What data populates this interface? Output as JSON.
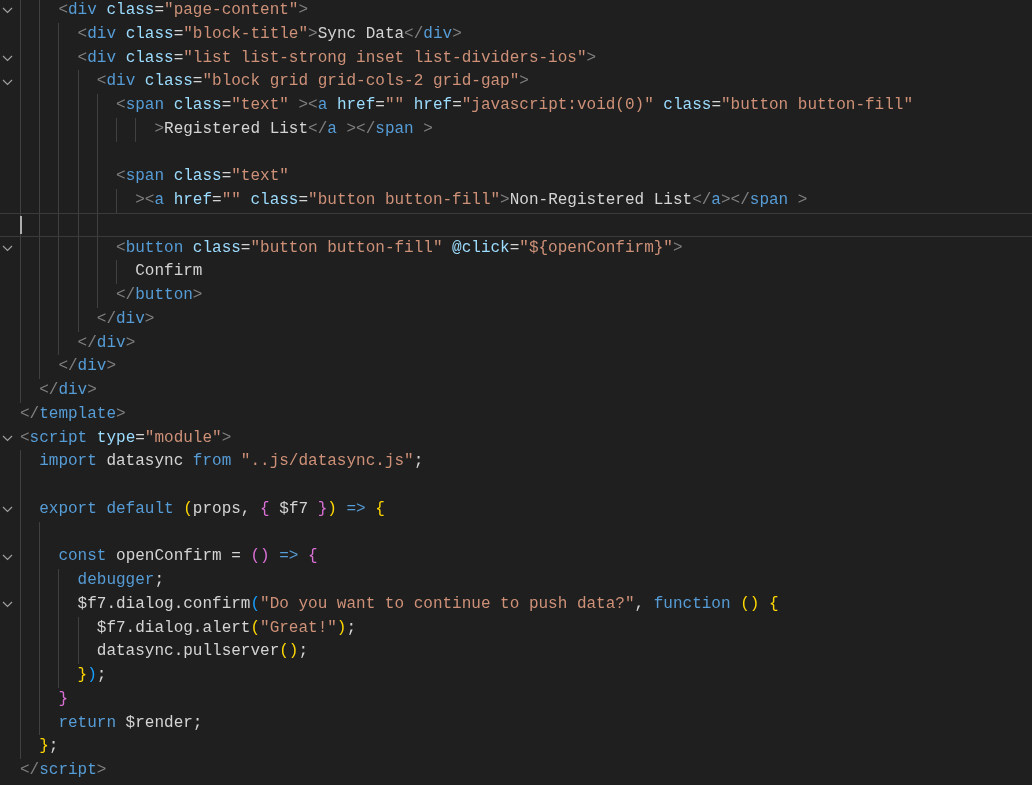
{
  "editor": {
    "lines": [
      {
        "foldable": true,
        "current": false,
        "tokens": [
          {
            "text": "    <",
            "kind": "punct"
          },
          {
            "text": "div",
            "kind": "tag"
          },
          {
            "text": " class",
            "kind": "attr"
          },
          {
            "text": "=",
            "kind": "text"
          },
          {
            "text": "\"page-content\"",
            "kind": "string"
          },
          {
            "text": ">",
            "kind": "punct"
          }
        ]
      },
      {
        "foldable": false,
        "current": false,
        "tokens": [
          {
            "text": "      <",
            "kind": "punct"
          },
          {
            "text": "div",
            "kind": "tag"
          },
          {
            "text": " class",
            "kind": "attr"
          },
          {
            "text": "=",
            "kind": "text"
          },
          {
            "text": "\"block-title\"",
            "kind": "string"
          },
          {
            "text": ">",
            "kind": "punct"
          },
          {
            "text": "Sync Data",
            "kind": "text"
          },
          {
            "text": "</",
            "kind": "punct"
          },
          {
            "text": "div",
            "kind": "tag"
          },
          {
            "text": ">",
            "kind": "punct"
          }
        ]
      },
      {
        "foldable": true,
        "current": false,
        "tokens": [
          {
            "text": "      <",
            "kind": "punct"
          },
          {
            "text": "div",
            "kind": "tag"
          },
          {
            "text": " class",
            "kind": "attr"
          },
          {
            "text": "=",
            "kind": "text"
          },
          {
            "text": "\"list list-strong inset list-dividers-ios\"",
            "kind": "string"
          },
          {
            "text": ">",
            "kind": "punct"
          }
        ]
      },
      {
        "foldable": true,
        "current": false,
        "tokens": [
          {
            "text": "        <",
            "kind": "punct"
          },
          {
            "text": "div",
            "kind": "tag"
          },
          {
            "text": " class",
            "kind": "attr"
          },
          {
            "text": "=",
            "kind": "text"
          },
          {
            "text": "\"block grid grid-cols-2 grid-gap\"",
            "kind": "string"
          },
          {
            "text": ">",
            "kind": "punct"
          }
        ]
      },
      {
        "foldable": false,
        "current": false,
        "tokens": [
          {
            "text": "          <",
            "kind": "punct"
          },
          {
            "text": "span",
            "kind": "tag"
          },
          {
            "text": " class",
            "kind": "attr"
          },
          {
            "text": "=",
            "kind": "text"
          },
          {
            "text": "\"text\"",
            "kind": "string"
          },
          {
            "text": " ><",
            "kind": "punct"
          },
          {
            "text": "a",
            "kind": "tag"
          },
          {
            "text": " href",
            "kind": "attr"
          },
          {
            "text": "=",
            "kind": "text"
          },
          {
            "text": "\"\"",
            "kind": "string"
          },
          {
            "text": " href",
            "kind": "attr"
          },
          {
            "text": "=",
            "kind": "text"
          },
          {
            "text": "\"javascript:void(0)\"",
            "kind": "string"
          },
          {
            "text": " class",
            "kind": "attr"
          },
          {
            "text": "=",
            "kind": "text"
          },
          {
            "text": "\"button button-fill\"",
            "kind": "string"
          }
        ]
      },
      {
        "foldable": false,
        "current": false,
        "tokens": [
          {
            "text": "              >",
            "kind": "punct"
          },
          {
            "text": "Registered List",
            "kind": "text"
          },
          {
            "text": "</",
            "kind": "punct"
          },
          {
            "text": "a",
            "kind": "tag"
          },
          {
            "text": " ></",
            "kind": "punct"
          },
          {
            "text": "span",
            "kind": "tag"
          },
          {
            "text": " >",
            "kind": "punct"
          }
        ]
      },
      {
        "foldable": false,
        "current": false
      },
      {
        "foldable": false,
        "current": false,
        "tokens": [
          {
            "text": "          <",
            "kind": "punct"
          },
          {
            "text": "span",
            "kind": "tag"
          },
          {
            "text": " class",
            "kind": "attr"
          },
          {
            "text": "=",
            "kind": "text"
          },
          {
            "text": "\"text\"",
            "kind": "string"
          }
        ]
      },
      {
        "foldable": false,
        "current": false,
        "tokens": [
          {
            "text": "            ><",
            "kind": "punct"
          },
          {
            "text": "a",
            "kind": "tag"
          },
          {
            "text": " href",
            "kind": "attr"
          },
          {
            "text": "=",
            "kind": "text"
          },
          {
            "text": "\"\"",
            "kind": "string"
          },
          {
            "text": " class",
            "kind": "attr"
          },
          {
            "text": "=",
            "kind": "text"
          },
          {
            "text": "\"button button-fill\"",
            "kind": "string"
          },
          {
            "text": ">",
            "kind": "punct"
          },
          {
            "text": "Non-Registered List",
            "kind": "text"
          },
          {
            "text": "</",
            "kind": "punct"
          },
          {
            "text": "a",
            "kind": "tag"
          },
          {
            "text": "></",
            "kind": "punct"
          },
          {
            "text": "span",
            "kind": "tag"
          },
          {
            "text": " >",
            "kind": "punct"
          }
        ]
      },
      {
        "foldable": false,
        "current": true
      },
      {
        "foldable": true,
        "current": false,
        "tokens": [
          {
            "text": "          <",
            "kind": "punct"
          },
          {
            "text": "button",
            "kind": "tag"
          },
          {
            "text": " class",
            "kind": "attr"
          },
          {
            "text": "=",
            "kind": "text"
          },
          {
            "text": "\"button button-fill\"",
            "kind": "string"
          },
          {
            "text": " @click",
            "kind": "attr"
          },
          {
            "text": "=",
            "kind": "text"
          },
          {
            "text": "\"${openConfirm}\"",
            "kind": "string"
          },
          {
            "text": ">",
            "kind": "punct"
          }
        ]
      },
      {
        "foldable": false,
        "current": false,
        "tokens": [
          {
            "text": "            Confirm",
            "kind": "text"
          }
        ]
      },
      {
        "foldable": false,
        "current": false,
        "tokens": [
          {
            "text": "          </",
            "kind": "punct"
          },
          {
            "text": "button",
            "kind": "tag"
          },
          {
            "text": ">",
            "kind": "punct"
          }
        ]
      },
      {
        "foldable": false,
        "current": false,
        "tokens": [
          {
            "text": "        </",
            "kind": "punct"
          },
          {
            "text": "div",
            "kind": "tag"
          },
          {
            "text": ">",
            "kind": "punct"
          }
        ]
      },
      {
        "foldable": false,
        "current": false,
        "tokens": [
          {
            "text": "      </",
            "kind": "punct"
          },
          {
            "text": "div",
            "kind": "tag"
          },
          {
            "text": ">",
            "kind": "punct"
          }
        ]
      },
      {
        "foldable": false,
        "current": false,
        "tokens": [
          {
            "text": "    </",
            "kind": "punct"
          },
          {
            "text": "div",
            "kind": "tag"
          },
          {
            "text": ">",
            "kind": "punct"
          }
        ]
      },
      {
        "foldable": false,
        "current": false,
        "tokens": [
          {
            "text": "  </",
            "kind": "punct"
          },
          {
            "text": "div",
            "kind": "tag"
          },
          {
            "text": ">",
            "kind": "punct"
          }
        ]
      },
      {
        "foldable": false,
        "current": false,
        "tokens": [
          {
            "text": "</",
            "kind": "punct"
          },
          {
            "text": "template",
            "kind": "tag"
          },
          {
            "text": ">",
            "kind": "punct"
          }
        ]
      },
      {
        "foldable": true,
        "current": false,
        "tokens": [
          {
            "text": "<",
            "kind": "punct"
          },
          {
            "text": "script",
            "kind": "tag"
          },
          {
            "text": " type",
            "kind": "attr"
          },
          {
            "text": "=",
            "kind": "text"
          },
          {
            "text": "\"module\"",
            "kind": "string"
          },
          {
            "text": ">",
            "kind": "punct"
          }
        ]
      },
      {
        "foldable": false,
        "current": false,
        "tokens": [
          {
            "text": "  import",
            "kind": "keyword"
          },
          {
            "text": " datasync ",
            "kind": "text"
          },
          {
            "text": "from",
            "kind": "keyword"
          },
          {
            "text": " \"..js/datasync.js\"",
            "kind": "string"
          },
          {
            "text": ";",
            "kind": "text"
          }
        ]
      },
      {
        "foldable": false,
        "current": false
      },
      {
        "foldable": true,
        "current": false,
        "tokens": [
          {
            "text": "  export default ",
            "kind": "keyword"
          },
          {
            "text": "(",
            "kind": "brace1"
          },
          {
            "text": "props, ",
            "kind": "text"
          },
          {
            "text": "{",
            "kind": "brace2"
          },
          {
            "text": " $f7 ",
            "kind": "text"
          },
          {
            "text": "}",
            "kind": "brace2"
          },
          {
            "text": ")",
            "kind": "brace1"
          },
          {
            "text": " => ",
            "kind": "keyword"
          },
          {
            "text": "{",
            "kind": "brace1"
          }
        ]
      },
      {
        "foldable": false,
        "current": false
      },
      {
        "foldable": true,
        "current": false,
        "tokens": [
          {
            "text": "    const",
            "kind": "keyword"
          },
          {
            "text": " openConfirm = ",
            "kind": "text"
          },
          {
            "text": "()",
            "kind": "brace2"
          },
          {
            "text": " => ",
            "kind": "keyword"
          },
          {
            "text": "{",
            "kind": "brace2"
          }
        ]
      },
      {
        "foldable": false,
        "current": false,
        "tokens": [
          {
            "text": "      debugger",
            "kind": "keyword"
          },
          {
            "text": ";",
            "kind": "text"
          }
        ]
      },
      {
        "foldable": true,
        "current": false,
        "tokens": [
          {
            "text": "      $f7.dialog.confirm",
            "kind": "text"
          },
          {
            "text": "(",
            "kind": "brace3"
          },
          {
            "text": "\"Do you want to continue to push data?\"",
            "kind": "string"
          },
          {
            "text": ", ",
            "kind": "text"
          },
          {
            "text": "function ",
            "kind": "keyword"
          },
          {
            "text": "() ",
            "kind": "brace1"
          },
          {
            "text": "{",
            "kind": "brace1"
          }
        ]
      },
      {
        "foldable": false,
        "current": false,
        "tokens": [
          {
            "text": "        $f7.dialog.alert",
            "kind": "text"
          },
          {
            "text": "(",
            "kind": "brace1"
          },
          {
            "text": "\"Great!\"",
            "kind": "string"
          },
          {
            "text": ")",
            "kind": "brace1"
          },
          {
            "text": ";",
            "kind": "text"
          }
        ]
      },
      {
        "foldable": false,
        "current": false,
        "tokens": [
          {
            "text": "        datasync.pullserver",
            "kind": "text"
          },
          {
            "text": "()",
            "kind": "brace1"
          },
          {
            "text": ";",
            "kind": "text"
          }
        ]
      },
      {
        "foldable": false,
        "current": false,
        "tokens": [
          {
            "text": "      }",
            "kind": "brace1"
          },
          {
            "text": ")",
            "kind": "brace3"
          },
          {
            "text": ";",
            "kind": "text"
          }
        ]
      },
      {
        "foldable": false,
        "current": false,
        "tokens": [
          {
            "text": "    }",
            "kind": "brace2"
          }
        ]
      },
      {
        "foldable": false,
        "current": false,
        "tokens": [
          {
            "text": "    return",
            "kind": "keyword"
          },
          {
            "text": " $render;",
            "kind": "text"
          }
        ]
      },
      {
        "foldable": false,
        "current": false,
        "tokens": [
          {
            "text": "  }",
            "kind": "brace1"
          },
          {
            "text": ";",
            "kind": "text"
          }
        ]
      },
      {
        "foldable": false,
        "current": false,
        "tokens": [
          {
            "text": "</",
            "kind": "punct"
          },
          {
            "text": "script",
            "kind": "tag"
          },
          {
            "text": ">",
            "kind": "punct"
          }
        ]
      }
    ]
  }
}
